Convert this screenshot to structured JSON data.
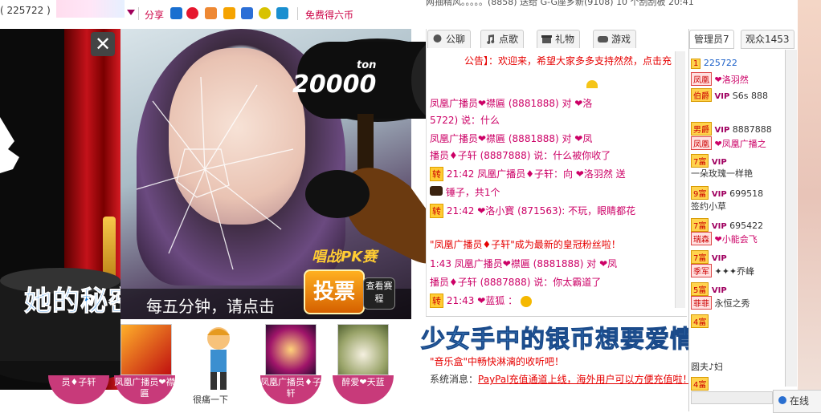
{
  "top": {
    "room_id": "( 225722 )",
    "share_label": "分享",
    "free_link": "免费得六币",
    "top_notice": "网抽精风。。。。。(8858) 送给 G-G座乡新(9108) 10 个刮刮板 20:41"
  },
  "show": {
    "secret_text": "她的秘密",
    "close_label": "✕"
  },
  "video": {
    "vote_tip": "每五分钟，请点击",
    "pk_badge": "唱战PK赛",
    "vote_button": "投票",
    "see_button": "查看赛程",
    "hammer_text": "20000",
    "hammer_unit": "ton"
  },
  "gifts": [
    {
      "label": "员♦子轩"
    },
    {
      "label": "凤凰广播员❤襟匾"
    },
    {
      "label": "很痛一下"
    },
    {
      "label": "凤凰广播员♦子轩"
    },
    {
      "label": "醉爱❤天蓝"
    }
  ],
  "chat": {
    "tabs": [
      {
        "label": "公聊",
        "icon": "chat-icon"
      },
      {
        "label": "点歌",
        "icon": "music-icon"
      },
      {
        "label": "礼物",
        "icon": "gift-icon"
      },
      {
        "label": "游戏",
        "icon": "game-icon"
      }
    ],
    "announcement": "公告】：欢迎来，希望大家多多支持然然，点击充",
    "lines": [
      {
        "text": "凤凰广播员❤襟匾 (8881888) 对 ❤洛"
      },
      {
        "text": "5722) 说：什么"
      },
      {
        "text": "凤凰广播员❤襟匾 (8881888) 对 ❤凤"
      },
      {
        "text": "播员♦子轩 (8887888) 说：什么被你收了"
      },
      {
        "text": "21:42 凤凰广播员♦子轩：向 ❤洛羽然 送"
      },
      {
        "text": "锤子，共1个"
      },
      {
        "text": "21:42 ❤洛小寳 (871563): 不玩，眼睛都花"
      },
      {
        "text": "\"凤凰广播员♦子轩\"成为最新的皇冠粉丝啦！"
      },
      {
        "text": "1:43 凤凰广播员❤襟匾 (8881888) 对 ❤凤"
      },
      {
        "text": "播员♦子轩 (8887888) 说：你太霸道了"
      },
      {
        "text": "21:43 ❤蓝狐 ："
      }
    ],
    "tag_zhuan": "转",
    "system_label": "系统消息：",
    "system_msg": "PayPal充值通道上线，海外用户可以方便充值啦！",
    "music_msg": "\"音乐盒\"中畅快淋漓的收听吧！",
    "overlay_song": "少女手中的银币想要爱情"
  },
  "userlist": {
    "tabs": [
      {
        "label": "管理员7"
      },
      {
        "label": "观众1453"
      }
    ],
    "rows": [
      {
        "rank": "1",
        "vip": "",
        "name": "225722"
      },
      {
        "rank": "凤凰",
        "vip": "",
        "name": "❤洛羽然"
      },
      {
        "rank": "伯爵",
        "vip": "VIP",
        "name": "S6s 888"
      },
      {
        "rank": "男爵",
        "vip": "VIP",
        "name": "8887888"
      },
      {
        "rank": "凤凰",
        "vip": "",
        "name": "❤凤凰广播之"
      },
      {
        "rank": "7富",
        "vip": "VIP",
        "name": "一朵玫瑰一样艳"
      },
      {
        "rank": "9富",
        "vip": "VIP",
        "name": "699518"
      },
      {
        "rank": "",
        "vip": "",
        "name": "签约小草"
      },
      {
        "rank": "7富",
        "vip": "VIP",
        "name": "695422"
      },
      {
        "rank": "瑞森",
        "vip": "",
        "name": "❤小能会飞"
      },
      {
        "rank": "7富",
        "vip": "VIP",
        "name": ""
      },
      {
        "rank": "季军",
        "vip": "",
        "name": "✦✦✦乔峰"
      },
      {
        "rank": "5富",
        "vip": "VIP",
        "name": ""
      },
      {
        "rank": "菲菲",
        "vip": "",
        "name": "永恒之秀"
      },
      {
        "rank": "4富",
        "vip": "",
        "name": ""
      },
      {
        "rank": "",
        "vip": "",
        "name": "圆夫♪妇"
      },
      {
        "rank": "4富",
        "vip": "",
        "name": ""
      }
    ],
    "online_label": "在线"
  },
  "colors": {
    "accent_pink": "#cc0066",
    "link_red": "#e60000",
    "name_blue": "#1a5fc8"
  }
}
